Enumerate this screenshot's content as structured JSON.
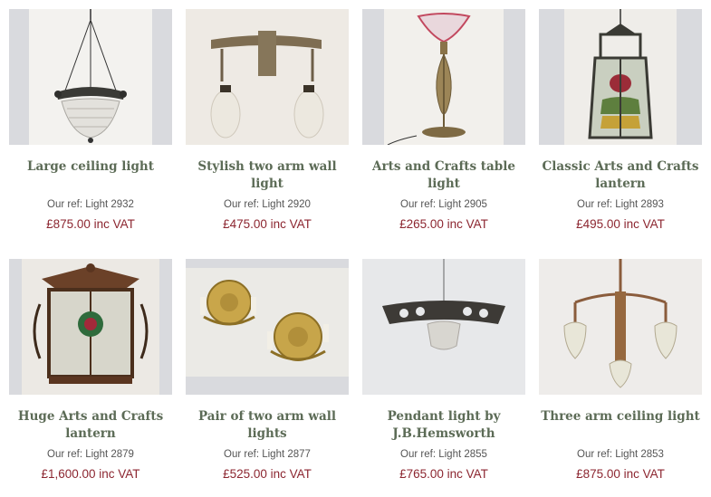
{
  "products": [
    {
      "title": "Large ceiling light",
      "ref": "Our ref:  Light 2932",
      "price": "£875.00 inc VAT",
      "image_icon": "ceiling-light-image"
    },
    {
      "title": "Stylish two arm wall light",
      "ref": "Our ref:  Light 2920",
      "price": "£475.00 inc VAT",
      "image_icon": "wall-light-image"
    },
    {
      "title": "Arts and Crafts table light",
      "ref": "Our ref:  Light 2905",
      "price": "£265.00 inc VAT",
      "image_icon": "table-light-image"
    },
    {
      "title": "Classic Arts and Crafts lantern",
      "ref": "Our ref:  Light 2893",
      "price": "£495.00 inc VAT",
      "image_icon": "lantern-image"
    },
    {
      "title": "Huge Arts and Crafts lantern",
      "ref": "Our ref:  Light 2879",
      "price": "£1,600.00 inc VAT",
      "image_icon": "huge-lantern-image"
    },
    {
      "title": "Pair of two arm wall lights",
      "ref": "Our ref:  Light 2877",
      "price": "£525.00 inc VAT",
      "image_icon": "wall-lights-pair-image"
    },
    {
      "title": "Pendant light by J.B.Hemsworth",
      "ref": "Our ref:  Light 2855",
      "price": "£765.00 inc VAT",
      "image_icon": "pendant-light-image"
    },
    {
      "title": "Three arm ceiling light",
      "ref": "Our ref:  Light 2853",
      "price": "£875.00 inc VAT",
      "image_icon": "three-arm-light-image"
    }
  ],
  "colors": {
    "title": "#5c6b56",
    "price": "#8c2630",
    "ref": "#555555",
    "thumb_bg": "#d9dade"
  }
}
